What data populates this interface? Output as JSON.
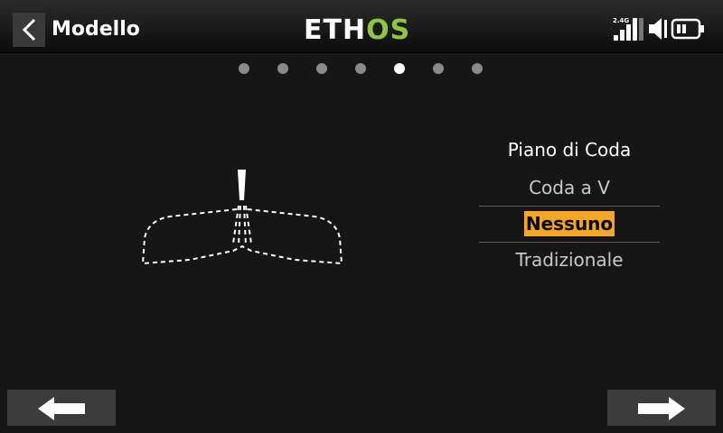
{
  "header": {
    "back_icon": "chevron-left-icon",
    "title": "Modello",
    "logo_left": "ETH",
    "logo_right": "OS",
    "signal_label": "2.4G",
    "logo_accent": "#8cc63f"
  },
  "pager": {
    "total": 7,
    "current": 5
  },
  "tail_options": {
    "heading": "Piano di Coda",
    "items": [
      "Coda a V",
      "Nessuno",
      "Tradizionale"
    ],
    "selected": "Nessuno",
    "highlight_color": "#f5a623"
  },
  "footer": {
    "prev_icon": "arrow-left-icon",
    "next_icon": "arrow-right-icon"
  }
}
